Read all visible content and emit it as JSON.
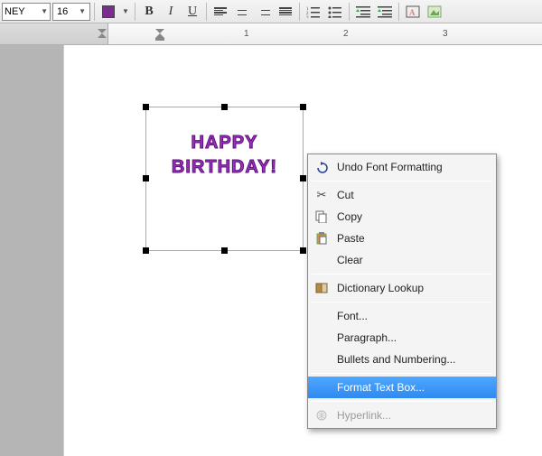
{
  "toolbar": {
    "font_name": "NEY",
    "font_size": "16",
    "bold": "B",
    "italic": "I",
    "underline": "U",
    "accent_color": "#7b2d8e"
  },
  "ruler": {
    "marks": [
      "1",
      "2",
      "3"
    ]
  },
  "textbox": {
    "line1": "HAPPY",
    "line2": "BIRTHDAY!"
  },
  "context_menu": {
    "undo": "Undo Font Formatting",
    "cut": "Cut",
    "copy": "Copy",
    "paste": "Paste",
    "clear": "Clear",
    "dictionary": "Dictionary Lookup",
    "font": "Font...",
    "paragraph": "Paragraph...",
    "bullets": "Bullets and Numbering...",
    "format_textbox": "Format Text Box...",
    "hyperlink": "Hyperlink..."
  }
}
